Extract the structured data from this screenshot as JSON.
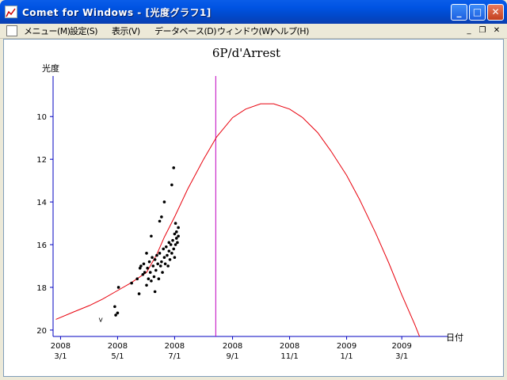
{
  "window": {
    "title": "Comet for Windows - [光度グラフ1]",
    "buttons": {
      "minimize": "_",
      "maximize": "□",
      "close": "✕"
    }
  },
  "menu": {
    "items": [
      "メニュー(M)",
      "設定(S)",
      "表示(V)",
      "データベース(D)",
      "ウィンドウ(W)",
      "ヘルプ(H)"
    ],
    "mdi_buttons": {
      "minimize": "_",
      "restore": "❐",
      "close": "✕"
    }
  },
  "colors": {
    "titlebar": "#0054e3",
    "curve": "#e8000c",
    "marker_line": "#c000c0",
    "axis": "#0000c0",
    "points": "#000000"
  },
  "chart_data": {
    "type": "scatter",
    "title": "6P/d'Arrest",
    "ylabel": "光度",
    "xlabel": "日付",
    "y_inverted": true,
    "ylim": [
      20.3,
      8.1
    ],
    "y_ticks": [
      10,
      12,
      14,
      16,
      18,
      20
    ],
    "x_ticks": [
      {
        "date": "2008-03-01",
        "line1": "2008",
        "line2": "3/1"
      },
      {
        "date": "2008-05-01",
        "line1": "2008",
        "line2": "5/1"
      },
      {
        "date": "2008-07-01",
        "line1": "2008",
        "line2": "7/1"
      },
      {
        "date": "2008-09-01",
        "line1": "2008",
        "line2": "9/1"
      },
      {
        "date": "2008-11-01",
        "line1": "2008",
        "line2": "11/1"
      },
      {
        "date": "2009-01-01",
        "line1": "2009",
        "line2": "1/1"
      },
      {
        "date": "2009-03-01",
        "line1": "2009",
        "line2": "3/1"
      }
    ],
    "marker_date": "2008-08-14",
    "curve": [
      [
        "2008-02-25",
        19.5
      ],
      [
        "2008-03-15",
        19.15
      ],
      [
        "2008-04-01",
        18.85
      ],
      [
        "2008-04-15",
        18.55
      ],
      [
        "2008-05-01",
        18.15
      ],
      [
        "2008-05-15",
        17.8
      ],
      [
        "2008-06-01",
        17.3
      ],
      [
        "2008-06-12",
        16.45
      ],
      [
        "2008-06-20",
        15.65
      ],
      [
        "2008-07-01",
        14.7
      ],
      [
        "2008-07-15",
        13.4
      ],
      [
        "2008-08-01",
        12.0
      ],
      [
        "2008-08-15",
        10.95
      ],
      [
        "2008-09-01",
        10.05
      ],
      [
        "2008-09-15",
        9.65
      ],
      [
        "2008-10-01",
        9.4
      ],
      [
        "2008-10-15",
        9.4
      ],
      [
        "2008-11-01",
        9.65
      ],
      [
        "2008-11-15",
        10.05
      ],
      [
        "2008-12-01",
        10.75
      ],
      [
        "2008-12-15",
        11.6
      ],
      [
        "2009-01-01",
        12.75
      ],
      [
        "2009-01-15",
        13.9
      ],
      [
        "2009-02-01",
        15.45
      ],
      [
        "2009-02-15",
        16.85
      ],
      [
        "2009-03-01",
        18.35
      ],
      [
        "2009-03-15",
        19.75
      ],
      [
        "2009-03-20",
        20.3
      ]
    ],
    "observations": [
      [
        "2008-04-28",
        18.9
      ],
      [
        "2008-04-29",
        19.3
      ],
      [
        "2008-05-01",
        19.2
      ],
      [
        "2008-05-02",
        18.0
      ],
      [
        "2008-05-16",
        17.8
      ],
      [
        "2008-05-22",
        17.6
      ],
      [
        "2008-05-24",
        18.3
      ],
      [
        "2008-05-25",
        17.1
      ],
      [
        "2008-05-26",
        17.0
      ],
      [
        "2008-05-28",
        17.4
      ],
      [
        "2008-05-29",
        16.9
      ],
      [
        "2008-05-30",
        17.3
      ],
      [
        "2008-06-01",
        16.4
      ],
      [
        "2008-06-01",
        17.9
      ],
      [
        "2008-06-02",
        17.1
      ],
      [
        "2008-06-03",
        17.6
      ],
      [
        "2008-06-04",
        16.8
      ],
      [
        "2008-06-05",
        17.3
      ],
      [
        "2008-06-06",
        15.6
      ],
      [
        "2008-06-06",
        17.7
      ],
      [
        "2008-06-07",
        16.6
      ],
      [
        "2008-06-08",
        17.0
      ],
      [
        "2008-06-09",
        17.5
      ],
      [
        "2008-06-10",
        16.7
      ],
      [
        "2008-06-10",
        18.2
      ],
      [
        "2008-06-11",
        17.2
      ],
      [
        "2008-06-12",
        16.5
      ],
      [
        "2008-06-13",
        16.9
      ],
      [
        "2008-06-14",
        17.6
      ],
      [
        "2008-06-15",
        14.9
      ],
      [
        "2008-06-15",
        16.4
      ],
      [
        "2008-06-16",
        17.0
      ],
      [
        "2008-06-17",
        14.7
      ],
      [
        "2008-06-17",
        16.8
      ],
      [
        "2008-06-18",
        17.3
      ],
      [
        "2008-06-19",
        16.2
      ],
      [
        "2008-06-20",
        14.0
      ],
      [
        "2008-06-20",
        16.6
      ],
      [
        "2008-06-21",
        16.9
      ],
      [
        "2008-06-22",
        16.1
      ],
      [
        "2008-06-23",
        16.5
      ],
      [
        "2008-06-24",
        17.0
      ],
      [
        "2008-06-25",
        15.9
      ],
      [
        "2008-06-25",
        16.3
      ],
      [
        "2008-06-26",
        16.7
      ],
      [
        "2008-06-27",
        16.0
      ],
      [
        "2008-06-28",
        13.2
      ],
      [
        "2008-06-28",
        16.4
      ],
      [
        "2008-06-29",
        15.8
      ],
      [
        "2008-06-30",
        12.4
      ],
      [
        "2008-06-30",
        16.2
      ],
      [
        "2008-07-01",
        15.5
      ],
      [
        "2008-07-01",
        16.6
      ],
      [
        "2008-07-02",
        15.0
      ],
      [
        "2008-07-02",
        16.0
      ],
      [
        "2008-07-03",
        15.7
      ],
      [
        "2008-07-03",
        15.4
      ],
      [
        "2008-07-04",
        15.9
      ],
      [
        "2008-07-05",
        15.6
      ],
      [
        "2008-07-05",
        15.2
      ]
    ],
    "annotations": [
      {
        "date": "2008-04-13",
        "mag": 19.5,
        "text": "v"
      }
    ]
  }
}
